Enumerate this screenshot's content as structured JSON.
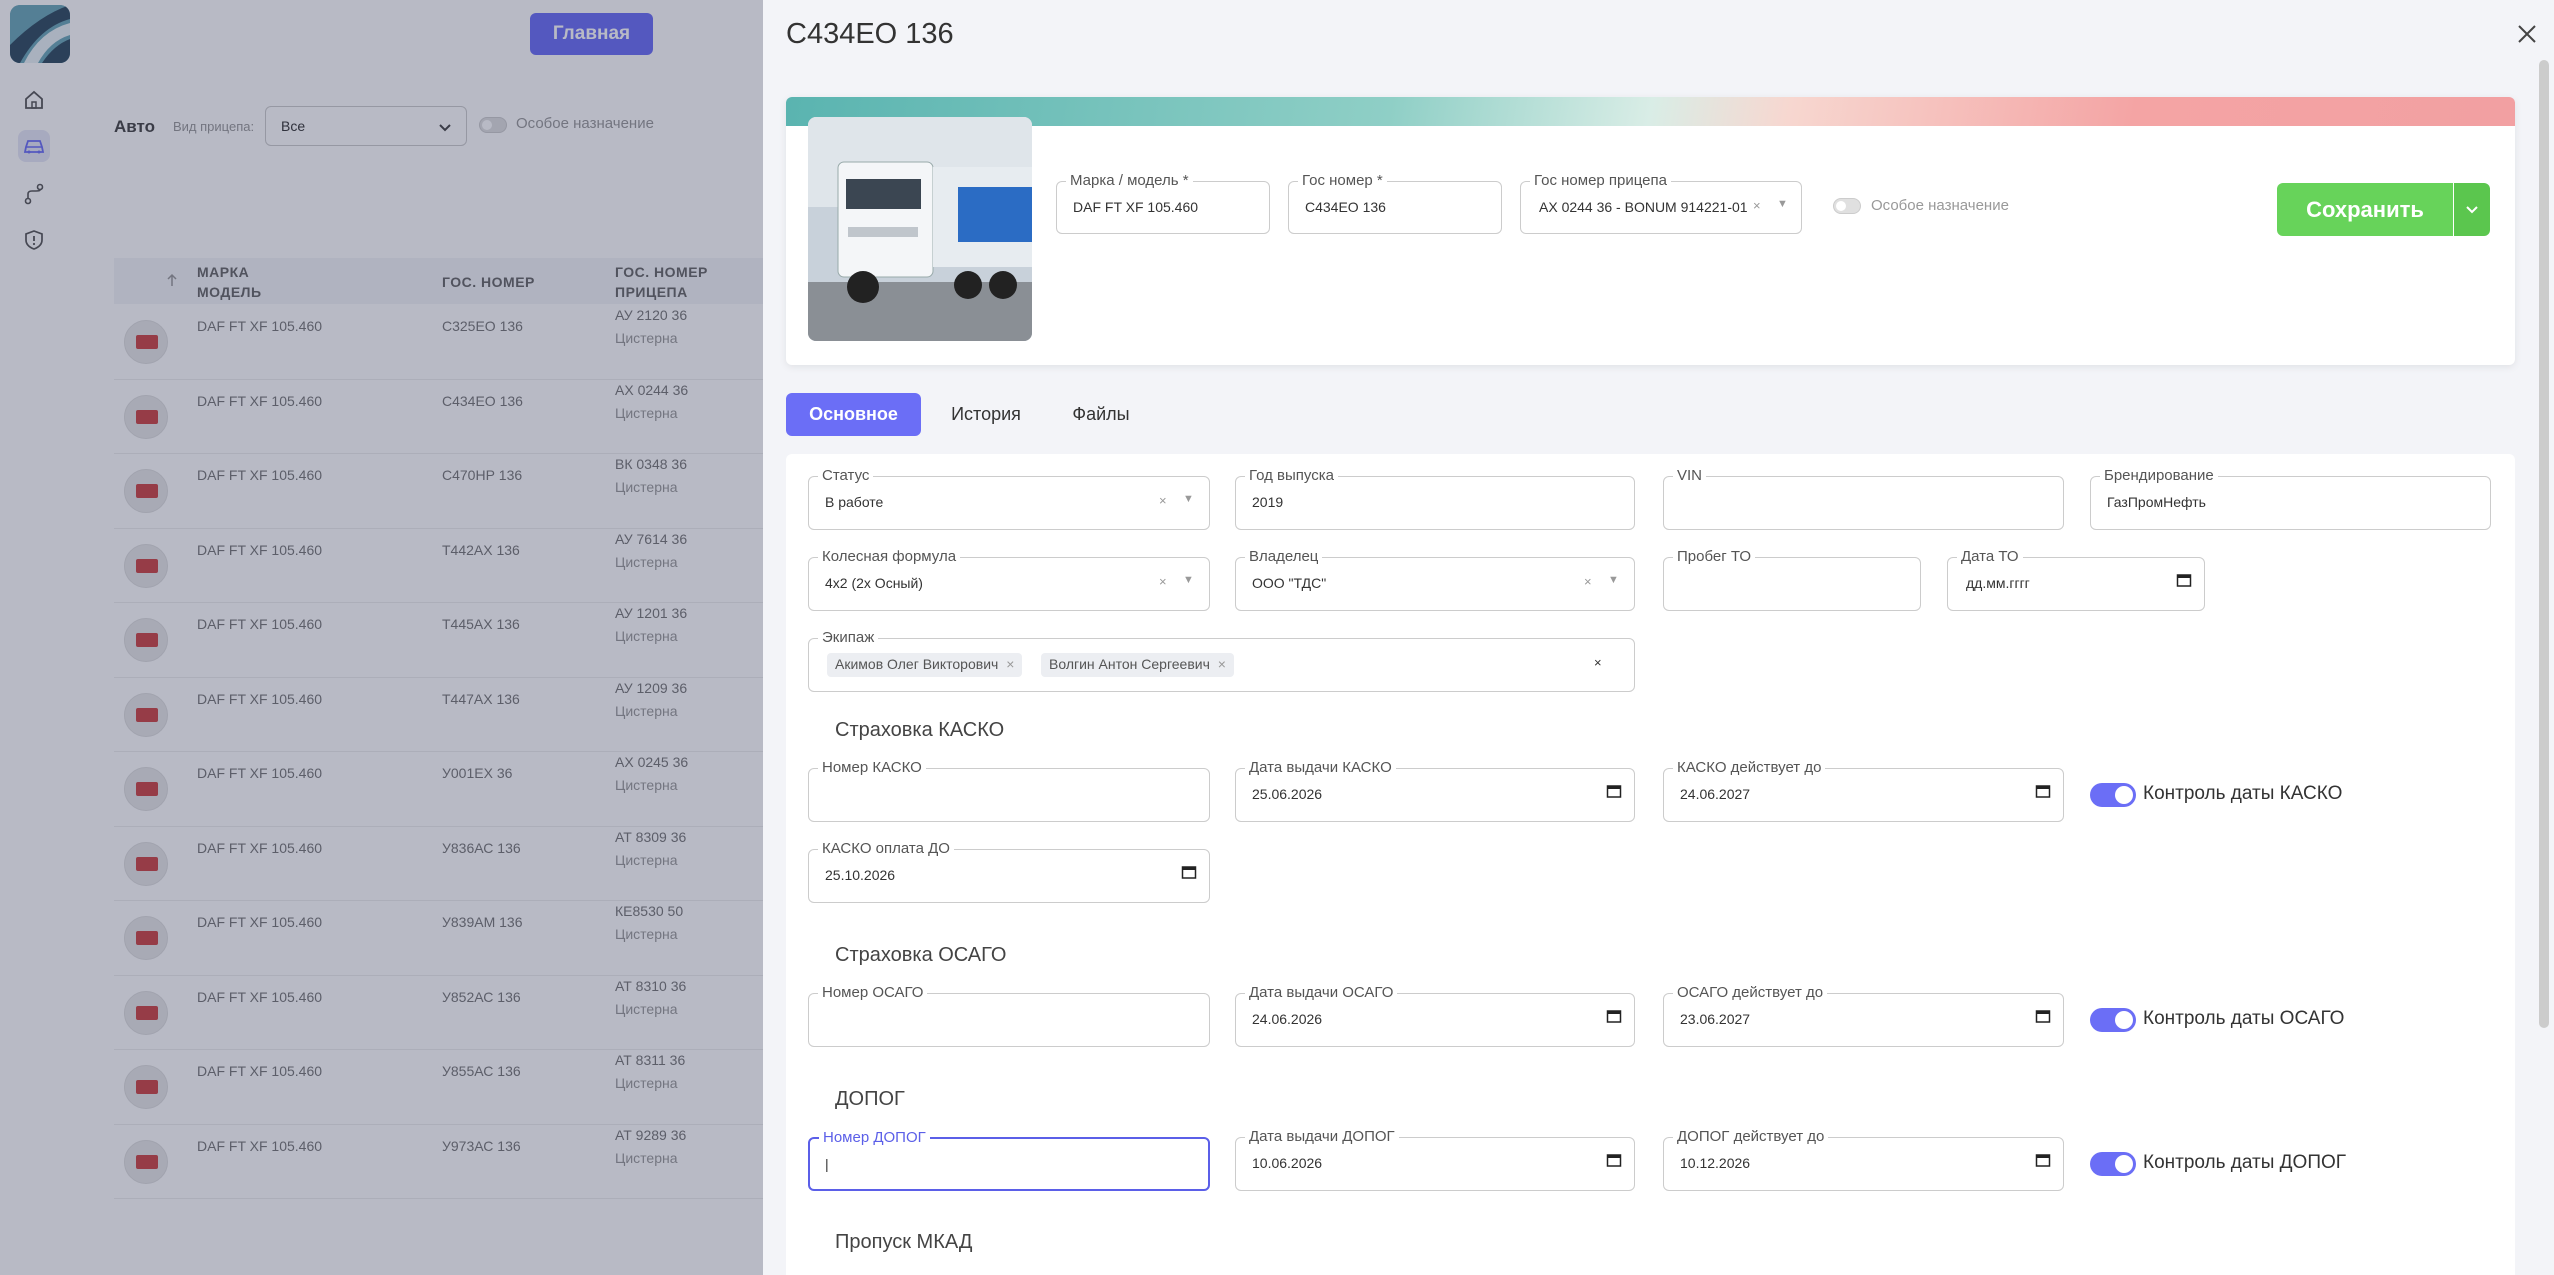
{
  "sidebar": {
    "icons": [
      "home-icon",
      "car-icon",
      "route-icon",
      "shield-icon"
    ]
  },
  "list": {
    "home_button": "Главная",
    "title": "Авто",
    "trailer_type_label": "Вид прицепа:",
    "trailer_type_value": "Все",
    "special_purpose_label": "Особое назначение",
    "columns": {
      "model": [
        "МАРКА",
        "МОДЕЛЬ"
      ],
      "plate": "ГОС. НОМЕР",
      "trailer_plate": [
        "ГОС. НОМЕР",
        "ПРИЦЕПА"
      ]
    },
    "rows": [
      {
        "model": "DAF FT XF 105.460",
        "plate": "С325ЕО 136",
        "trailer_plate": "АУ 2120 36",
        "trailer_type": "Цистерна"
      },
      {
        "model": "DAF FT XF 105.460",
        "plate": "С434ЕО 136",
        "trailer_plate": "АХ 0244 36",
        "trailer_type": "Цистерна"
      },
      {
        "model": "DAF FT XF 105.460",
        "plate": "С470НР 136",
        "trailer_plate": "ВК 0348 36",
        "trailer_type": "Цистерна"
      },
      {
        "model": "DAF FT XF 105.460",
        "plate": "Т442АХ 136",
        "trailer_plate": "АУ 7614 36",
        "trailer_type": "Цистерна"
      },
      {
        "model": "DAF FT XF 105.460",
        "plate": "Т445АХ 136",
        "trailer_plate": "АУ 1201 36",
        "trailer_type": "Цистерна"
      },
      {
        "model": "DAF FT XF 105.460",
        "plate": "Т447АХ 136",
        "trailer_plate": "АУ 1209 36",
        "trailer_type": "Цистерна"
      },
      {
        "model": "DAF FT XF 105.460",
        "plate": "У001ЕХ 36",
        "trailer_plate": "АХ 0245 36",
        "trailer_type": "Цистерна"
      },
      {
        "model": "DAF FT XF 105.460",
        "plate": "У836АС 136",
        "trailer_plate": "АТ 8309 36",
        "trailer_type": "Цистерна"
      },
      {
        "model": "DAF FT XF 105.460",
        "plate": "У839АМ 136",
        "trailer_plate": "КЕ8530 50",
        "trailer_type": "Цистерна"
      },
      {
        "model": "DAF FT XF 105.460",
        "plate": "У852АС 136",
        "trailer_plate": "АТ 8310 36",
        "trailer_type": "Цистерна"
      },
      {
        "model": "DAF FT XF 105.460",
        "plate": "У855АС 136",
        "trailer_plate": "АТ 8311 36",
        "trailer_type": "Цистерна"
      },
      {
        "model": "DAF FT XF 105.460",
        "plate": "У973АС 136",
        "trailer_plate": "АТ 9289 36",
        "trailer_type": "Цистерна"
      }
    ]
  },
  "drawer": {
    "title": "С434ЕО 136",
    "brand_model": {
      "label": "Марка / модель *",
      "value": "DAF FT XF 105.460"
    },
    "plate": {
      "label": "Гос номер *",
      "value": "С434ЕО 136"
    },
    "trailer_plate": {
      "label": "Гос номер прицепа",
      "value": "АХ 0244 36 - BONUM 914221-01"
    },
    "special_purpose_label": "Особое назначение",
    "save_label": "Сохранить",
    "tabs": [
      "Основное",
      "История",
      "Файлы"
    ],
    "fields": {
      "status": {
        "label": "Статус",
        "value": "В работе"
      },
      "year": {
        "label": "Год выпуска",
        "value": "2019"
      },
      "vin": {
        "label": "VIN",
        "value": ""
      },
      "branding": {
        "label": "Брендирование",
        "value": "ГазПромНефть"
      },
      "wheel_formula": {
        "label": "Колесная формула",
        "value": "4x2 (2х Осный)"
      },
      "owner": {
        "label": "Владелец",
        "value": "ООО \"ТДС\""
      },
      "mileage_to": {
        "label": "Пробег ТО",
        "value": ""
      },
      "date_to": {
        "label": "Дата ТО",
        "value": "дд.мм.гггг"
      },
      "crew": {
        "label": "Экипаж",
        "members": [
          "Акимов Олег Викторович",
          "Волгин Антон Сергеевич"
        ]
      }
    },
    "kasko": {
      "title": "Страховка КАСКО",
      "number": {
        "label": "Номер КАСКО",
        "value": ""
      },
      "issue_date": {
        "label": "Дата выдачи КАСКО",
        "value": "25.06.2026"
      },
      "valid_until": {
        "label": "КАСКО действует до",
        "value": "24.06.2027"
      },
      "control_label": "Контроль даты КАСКО",
      "paid_until": {
        "label": "КАСКО оплата ДО",
        "value": "25.10.2026"
      }
    },
    "osago": {
      "title": "Страховка ОСАГО",
      "number": {
        "label": "Номер ОСАГО",
        "value": ""
      },
      "issue_date": {
        "label": "Дата выдачи ОСАГО",
        "value": "24.06.2026"
      },
      "valid_until": {
        "label": "ОСАГО действует до",
        "value": "23.06.2027"
      },
      "control_label": "Контроль даты ОСАГО"
    },
    "dopog": {
      "title": "ДОПОГ",
      "number": {
        "label": "Номер ДОПОГ",
        "value": "|"
      },
      "issue_date": {
        "label": "Дата выдачи ДОПОГ",
        "value": "10.06.2026"
      },
      "valid_until": {
        "label": "ДОПОГ действует до",
        "value": "10.12.2026"
      },
      "control_label": "Контроль даты ДОПОГ"
    },
    "mkad": {
      "title": "Пропуск МКАД"
    }
  },
  "colors": {
    "accent": "#6b6ef6",
    "save": "#67d35a"
  }
}
